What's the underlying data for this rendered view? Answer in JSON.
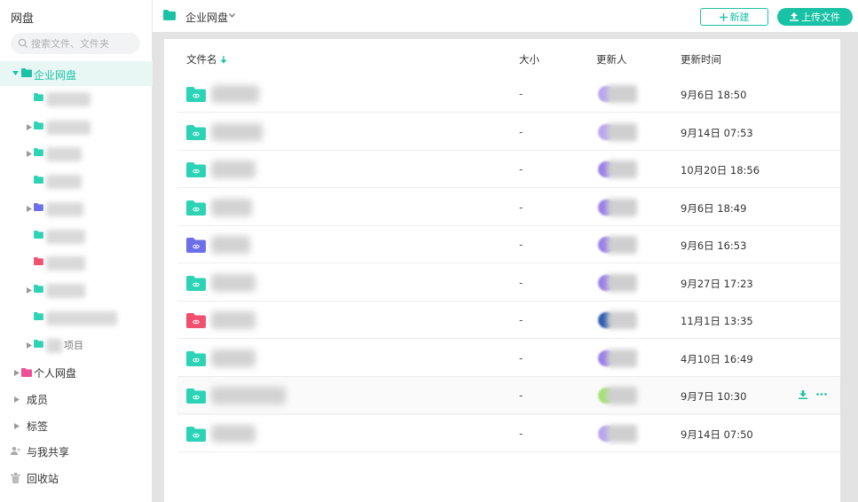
{
  "app": {
    "title": "网盘"
  },
  "search": {
    "placeholder": "搜索文件、文件夹"
  },
  "sidebar": {
    "root": {
      "label": "企业网盘"
    },
    "children_peek": [
      "",
      "",
      "",
      "",
      "",
      "",
      "",
      "",
      "",
      "项目"
    ],
    "nav": [
      {
        "label": "个人网盘"
      },
      {
        "label": "成员"
      },
      {
        "label": "标签"
      },
      {
        "label": "与我共享"
      },
      {
        "label": "回收站"
      }
    ]
  },
  "header": {
    "breadcrumb": "企业网盘",
    "new_label": "新建",
    "upload_label": "上传文件"
  },
  "table": {
    "columns": {
      "name": "文件名",
      "size": "大小",
      "updater": "更新人",
      "time": "更新时间"
    },
    "rows": [
      {
        "size": "-",
        "time": "9月6日 18:50",
        "folder_color": "#2cd3b5",
        "avatar_color": "#b9a6f0"
      },
      {
        "size": "-",
        "time": "9月14日 07:53",
        "folder_color": "#2cd3b5",
        "avatar_color": "#b9a6f0"
      },
      {
        "size": "-",
        "time": "10月20日 18:56",
        "folder_color": "#2cd3b5",
        "avatar_color": "#9b7fe8"
      },
      {
        "size": "-",
        "time": "9月6日 18:49",
        "folder_color": "#2cd3b5",
        "avatar_color": "#9b7fe8"
      },
      {
        "size": "-",
        "time": "9月6日 16:53",
        "folder_color": "#6c6fe8",
        "avatar_color": "#9b7fe8"
      },
      {
        "size": "-",
        "time": "9月27日 17:23",
        "folder_color": "#2cd3b5",
        "avatar_color": "#9b7fe8"
      },
      {
        "size": "-",
        "time": "11月1日 13:35",
        "folder_color": "#f0506e",
        "avatar_color": "#2f5fb0"
      },
      {
        "size": "-",
        "time": "4月10日 16:49",
        "folder_color": "#2cd3b5",
        "avatar_color": "#9b7fe8"
      },
      {
        "size": "-",
        "time": "9月7日 10:30",
        "folder_color": "#2cd3b5",
        "avatar_color": "#a8e07a"
      },
      {
        "size": "-",
        "time": "9月14日 07:50",
        "folder_color": "#2cd3b5",
        "avatar_color": "#b9a6f0"
      }
    ]
  },
  "colors": {
    "accent": "#19c2a5",
    "selected_bg": "#e8f7f4"
  },
  "icons": [
    "search-icon",
    "folder-icon",
    "chevron-down-icon",
    "plus-icon",
    "upload-icon",
    "sort-down-icon",
    "download-icon",
    "more-icon",
    "members-icon",
    "tag-icon",
    "share-icon",
    "trash-icon"
  ]
}
